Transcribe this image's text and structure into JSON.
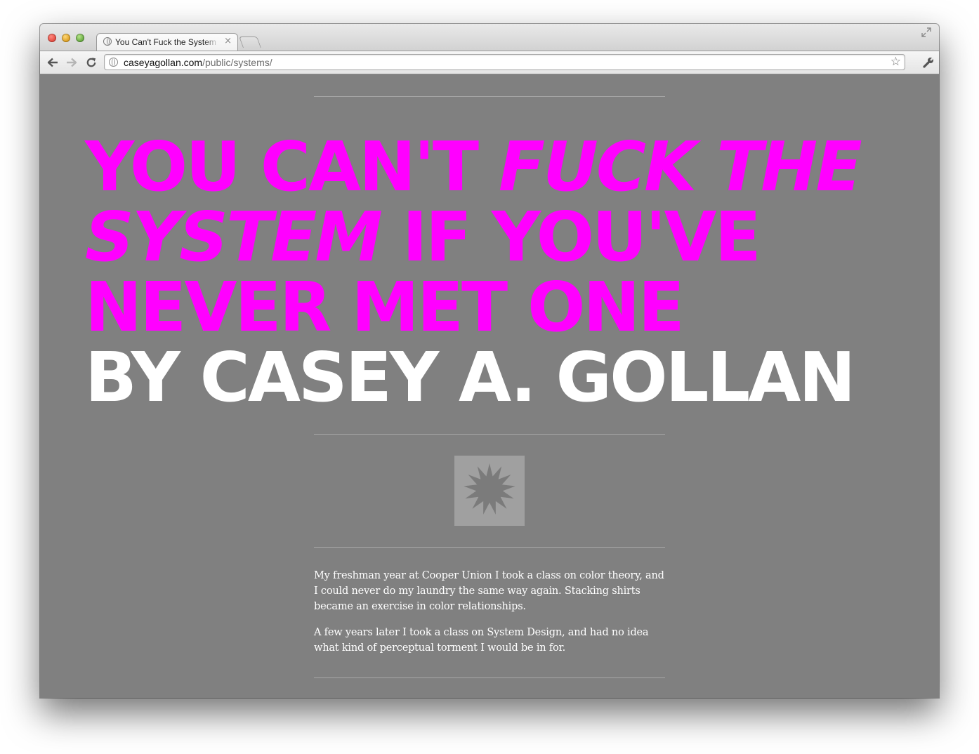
{
  "browser": {
    "tab_title": "You Can't Fuck the System If You've Never Met One",
    "tab_close": "×",
    "url_host": "caseyagollan.com",
    "url_path": "/public/systems/",
    "icons": {
      "favicon": "globe-icon",
      "back": "back-arrow-icon",
      "forward": "forward-arrow-icon",
      "reload": "reload-icon",
      "omnibox": "globe-icon",
      "bookmark": "star-icon",
      "settings": "wrench-icon",
      "fullscreen": "expand-icon"
    }
  },
  "page": {
    "background": "#808080",
    "accent": "#ff00ff",
    "headline": {
      "part1": "You can't ",
      "part2_italic": "fuck the system",
      "part3": " if you've never met one",
      "byline": "by Casey A. Gollan"
    },
    "badge_icon": "starburst-icon",
    "paragraphs": [
      "My freshman year at Cooper Union I took a class on color theory, and I could never do my laundry the same way again. Stacking shirts became an exercise in color relationships.",
      "A few years later I took a class on System Design, and had no idea what kind of perceptual torment I would be in for."
    ]
  }
}
